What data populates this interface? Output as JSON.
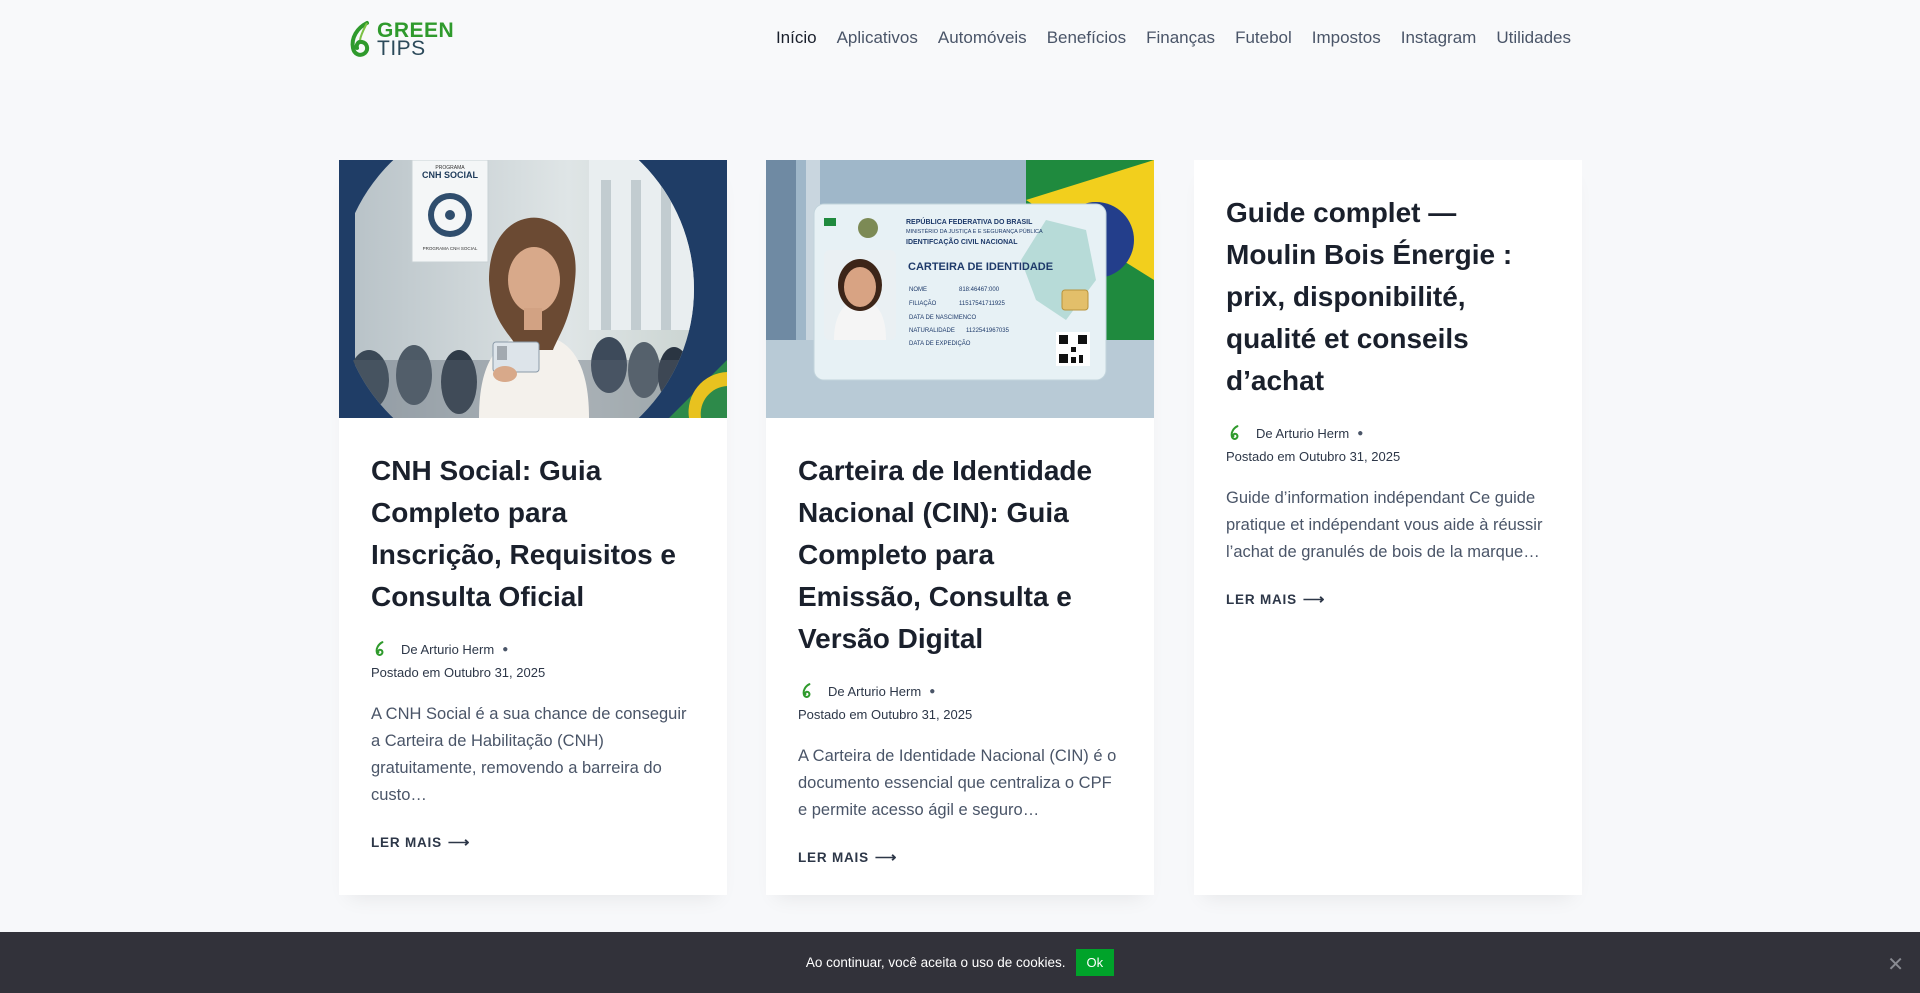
{
  "brand": {
    "line1": "GREEN",
    "line2": "TIPS",
    "color": "#2f9a2c"
  },
  "nav": {
    "items": [
      "Início",
      "Aplicativos",
      "Automóveis",
      "Benefícios",
      "Finanças",
      "Futebol",
      "Impostos",
      "Instagram",
      "Utilidades"
    ]
  },
  "posts": [
    {
      "title": "CNH Social: Guia Completo para Inscrição, Requisitos e Consulta Oficial",
      "author": "De Arturio Herm",
      "date": "Postado em Outubro 31, 2025",
      "excerpt": "A CNH Social é a sua chance de conseguir a Carteira de Habilitação (CNH) gratuitamente, removendo a barreira do custo…",
      "more": "LER MAIS",
      "image": {
        "sign_top": "PROGRAMA",
        "sign_title": "CNH SOCIAL",
        "sign_bottom": "PROGRAMA CNH SOCIAL"
      }
    },
    {
      "title": "Carteira de Identidade Nacional (CIN): Guia Completo para Emissão, Consulta e Versão Digital",
      "author": "De Arturio Herm",
      "date": "Postado em Outubro 31, 2025",
      "excerpt": "A Carteira de Identidade Nacional (CIN) é o documento essencial que centraliza o CPF e permite acesso ágil e seguro…",
      "more": "LER MAIS",
      "image": {
        "l1": "REPÚBLICA FEDERATIVA DO BRASIL",
        "l2": "MINISTÉRIO DA JUSTIÇA E E SEGURANÇA PÚBLICA",
        "l3": "IDENTIFCAÇÃO CIVIL NACIONAL",
        "heading": "CARTEIRA DE IDENTIDADE",
        "fields": [
          [
            "NOME",
            "818:46467:000"
          ],
          [
            "FILIAÇÃO",
            "11517541711925"
          ],
          [
            "DATA DE NASCIMENCO",
            ""
          ],
          [
            "NATURALIDADE",
            "1122541967035"
          ],
          [
            "DATA DE EXPEDIÇÃO",
            ""
          ]
        ]
      }
    },
    {
      "title": "Guide complet — Moulin Bois Énergie : prix, disponibilité, qualité et conseils d’achat",
      "author": "De Arturio Herm",
      "date": "Postado em Outubro 31, 2025",
      "excerpt": "Guide d’information indépendant Ce guide pratique et indépendant vous aide à réussir l’achat de granulés de bois de la marque…",
      "more": "LER MAIS"
    }
  ],
  "cookie": {
    "text": "Ao continuar, você aceita o uso de cookies.",
    "ok": "Ok",
    "close": "✕"
  }
}
